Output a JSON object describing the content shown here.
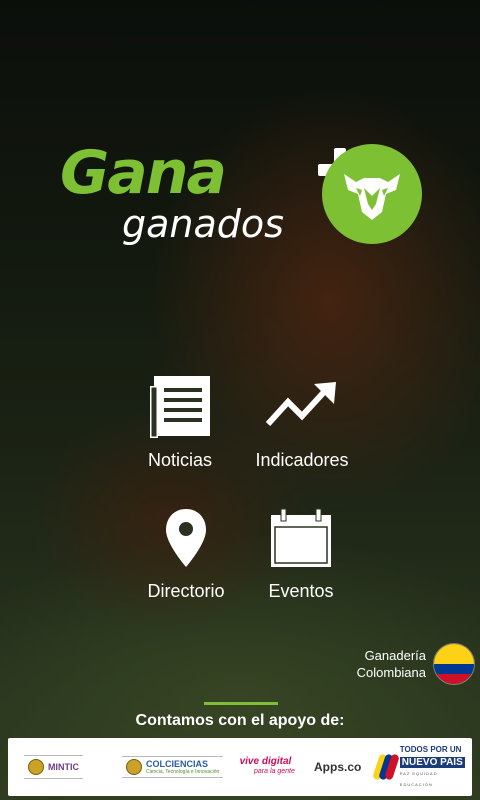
{
  "logo": {
    "word": "Gana",
    "sub": "ganados",
    "color": "#7dc033"
  },
  "menu": {
    "noticias": {
      "label": "Noticias",
      "icon": "newspaper-icon"
    },
    "indicadores": {
      "label": "Indicadores",
      "icon": "trend-arrow-icon"
    },
    "directorio": {
      "label": "Directorio",
      "icon": "map-pin-icon"
    },
    "eventos": {
      "label": "Eventos",
      "icon": "calendar-icon"
    }
  },
  "country": {
    "line1": "Ganadería",
    "line2": "Colombiana",
    "icon": "colombia-flag-icon"
  },
  "support": {
    "title": "Contamos con el apoyo de:"
  },
  "sponsors": {
    "mintic": "MINTIC",
    "colciencias": "COLCIENCIAS",
    "colciencias_tag": "Ciencia, Tecnología e Innovación",
    "vive_digital": "vive digital",
    "vive_digital_tag": "para la gente",
    "apps": "Apps.co",
    "todos_l1": "TODOS POR UN",
    "todos_l2": "NUEVO PAÍS",
    "todos_l3": "PAZ EQUIDAD EDUCACIÓN"
  }
}
